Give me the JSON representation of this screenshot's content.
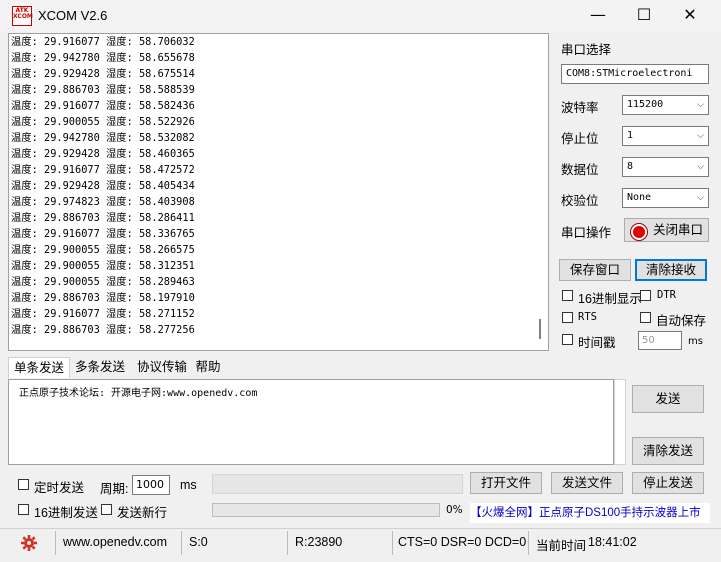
{
  "window": {
    "title": "XCOM V2.6",
    "logo_text": "ATK\nXCOM",
    "minimize": "—",
    "maximize": "☐",
    "close": "✕"
  },
  "receive": {
    "lines": [
      "温度: 29.916077 湿度: 58.706032",
      "温度: 29.942780 湿度: 58.655678",
      "温度: 29.929428 湿度: 58.675514",
      "温度: 29.886703 湿度: 58.588539",
      "温度: 29.916077 湿度: 58.582436",
      "温度: 29.900055 湿度: 58.522926",
      "温度: 29.942780 湿度: 58.532082",
      "温度: 29.929428 湿度: 58.460365",
      "温度: 29.916077 湿度: 58.472572",
      "温度: 29.929428 湿度: 58.405434",
      "温度: 29.974823 湿度: 58.403908",
      "温度: 29.886703 湿度: 58.286411",
      "温度: 29.916077 湿度: 58.336765",
      "温度: 29.900055 湿度: 58.266575",
      "温度: 29.900055 湿度: 58.312351",
      "温度: 29.900055 湿度: 58.289463",
      "温度: 29.886703 湿度: 58.197910",
      "温度: 29.916077 湿度: 58.271152",
      "温度: 29.886703 湿度: 58.277256"
    ]
  },
  "settings": {
    "port_label": "串口选择",
    "port_value": "COM8:STMicroelectroni",
    "baud_label": "波特率",
    "baud_value": "115200",
    "stop_label": "停止位",
    "stop_value": "1",
    "data_label": "数据位",
    "data_value": "8",
    "parity_label": "校验位",
    "parity_value": "None",
    "op_label": "串口操作",
    "close_port_button": "关闭串口",
    "save_window_button": "保存窗口",
    "clear_receive_button": "清除接收",
    "hex_display": "16进制显示",
    "dtr": "DTR",
    "rts": "RTS",
    "auto_save": "自动保存",
    "timestamp": "时间戳",
    "timestamp_value": "50",
    "timestamp_unit": "ms"
  },
  "tabs": [
    "单条发送",
    "多条发送",
    "协议传输",
    "帮助"
  ],
  "send": {
    "text": "正点原子技术论坛: 开源电子网:www.openedv.com",
    "send_button": "发送",
    "clear_send_button": "清除发送",
    "timed_send": "定时发送",
    "period_label": "周期:",
    "period_value": "1000",
    "period_unit": "ms",
    "open_file_button": "打开文件",
    "send_file_button": "发送文件",
    "stop_send_button": "停止发送",
    "hex_send": "16进制发送",
    "send_newline": "发送新行",
    "progress_text": "0%",
    "progress": 0,
    "ad_text": "【火爆全网】正点原子DS100手持示波器上市"
  },
  "status": {
    "url": "www.openedv.com",
    "sent": "S:0",
    "received": "R:23890",
    "signals": "CTS=0 DSR=0 DCD=0",
    "time_label": "当前时间",
    "time_value": "18:41:02"
  },
  "colors": {
    "led_red": "#e00000",
    "ad_blue": "#0000cc",
    "gear_red": "#d03020"
  }
}
